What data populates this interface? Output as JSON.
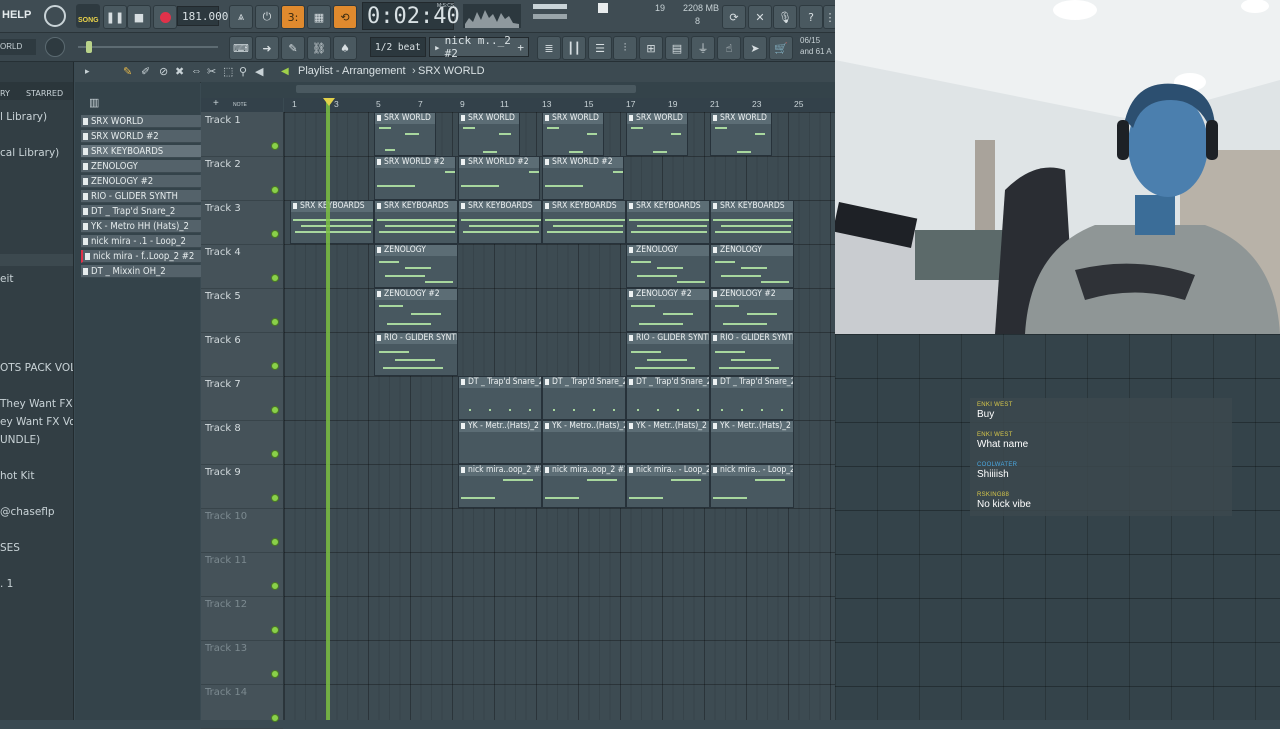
{
  "menu": {
    "help_label": "HELP",
    "song_label": "SONG"
  },
  "transport": {
    "tempo": "181.000",
    "time": "0:02:40",
    "time_unit": "M:S:CS",
    "cpu_voices": "19",
    "memory": "2208 MB",
    "poly": "8",
    "snap_label": "1/2 beat",
    "pattern_selector": "nick m.._2 #2",
    "news_date": "06/15",
    "news_text": "and 61 A"
  },
  "browser": {
    "items": [
      "ORLD",
      "RY",
      "STARRED",
      "l Library)",
      "cal Library)",
      "eit",
      "OTS PACK VOL 2",
      "They Want FX",
      "ey Want FX Vol 2",
      "UNDLE)",
      "hot Kit",
      "@chaseflp",
      "SES",
      ". 1"
    ]
  },
  "playlist": {
    "title": "Playlist - Arrangement",
    "breadcrumb": "SRX WORLD",
    "patterns": [
      "SRX WORLD",
      "SRX WORLD #2",
      "SRX KEYBOARDS",
      "ZENOLOGY",
      "ZENOLOGY #2",
      "RIO - GLIDER SYNTH",
      "DT _ Trap'd Snare_2",
      "YK - Metro HH (Hats)_2",
      "nick mira - .1 - Loop_2",
      "nick mira - f..Loop_2 #2",
      "DT _ Mixxin OH_2"
    ],
    "ruler": [
      "1",
      "3",
      "5",
      "7",
      "9",
      "11",
      "13",
      "15",
      "17",
      "19",
      "21",
      "23",
      "25"
    ],
    "tracks": [
      "Track 1",
      "Track 2",
      "Track 3",
      "Track 4",
      "Track 5",
      "Track 6",
      "Track 7",
      "Track 8",
      "Track 9",
      "Track 10",
      "Track 11",
      "Track 12",
      "Track 13",
      "Track 14"
    ],
    "clip_labels": {
      "t1": "SRX WORLD",
      "t2": "SRX WORLD #2",
      "t3": "SRX KEYBOARDS",
      "t4": "ZENOLOGY",
      "t5": "ZENOLOGY #2",
      "t6": "RIO - GLIDER SYNTH",
      "t7": "DT _ Trap'd Snare_2",
      "t8": "YK - Metr..(Hats)_2",
      "t8b": "YK - Metro..(Hats)_2",
      "t9a": "nick mira..oop_2 #2",
      "t9b": "nick mira.. - Loop_2"
    }
  },
  "chat": {
    "messages": [
      {
        "user": "ENKI WEST",
        "text": "Buy"
      },
      {
        "user": "ENKI WEST",
        "text": "What name"
      },
      {
        "user": "COOLWATER",
        "text": "Shiiiish"
      },
      {
        "user": "RSKING88",
        "text": "No kick vibe"
      }
    ]
  },
  "colors": {
    "playhead": "#7bc043",
    "accent": "#e08a2e",
    "record": "#e0324a"
  }
}
